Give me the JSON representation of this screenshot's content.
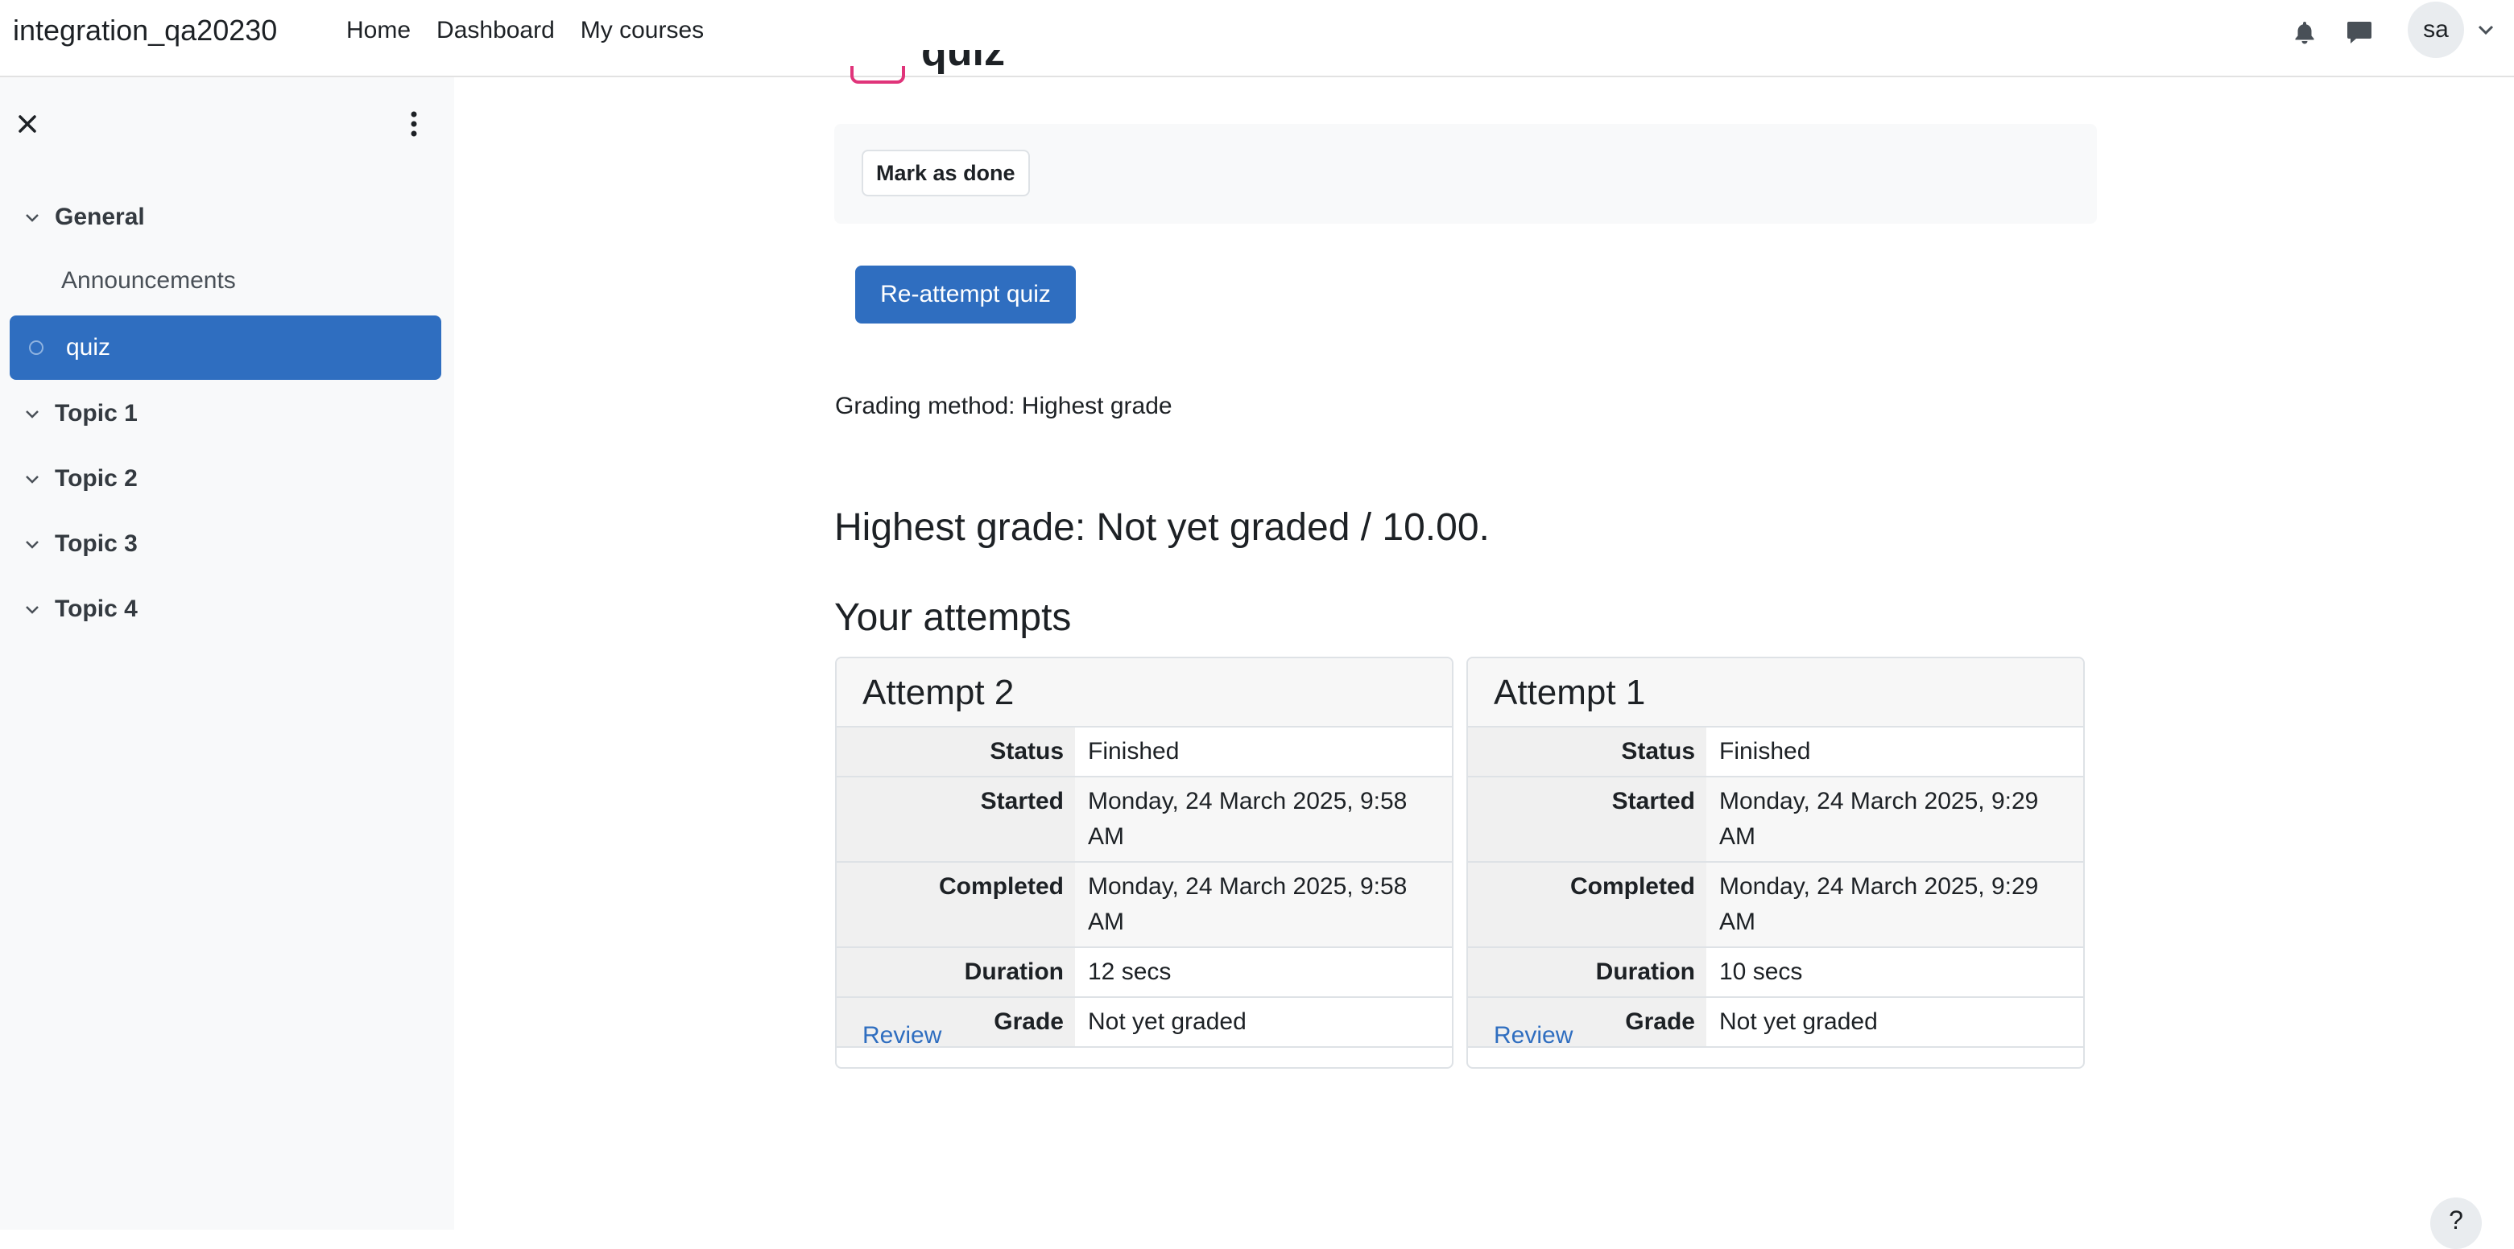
{
  "navbar": {
    "site_name": "integration_qa20230",
    "links": [
      "Home",
      "Dashboard",
      "My courses"
    ],
    "avatar_initials": "sa",
    "icons": [
      "bell-icon",
      "chat-icon",
      "chevron-down-icon"
    ]
  },
  "drawer": {
    "sections": [
      {
        "label": "General"
      },
      {
        "label": "Topic 1"
      },
      {
        "label": "Topic 2"
      },
      {
        "label": "Topic 3"
      },
      {
        "label": "Topic 4"
      }
    ],
    "activities": [
      "Announcements",
      "quiz"
    ]
  },
  "main": {
    "title_partial": "quiz",
    "mark_done_label": "Mark as done",
    "reattempt_label": "Re-attempt quiz",
    "grading_method": "Grading method: Highest grade",
    "highest_grade": "Highest grade: Not yet graded / 10.00.",
    "attempts_heading": "Your attempts",
    "attempts": [
      {
        "title": "Attempt 2",
        "rows": [
          {
            "label": "Status",
            "value": "Finished"
          },
          {
            "label": "Started",
            "value": "Monday, 24 March 2025, 9:58 AM"
          },
          {
            "label": "Completed",
            "value": "Monday, 24 March 2025, 9:58 AM"
          },
          {
            "label": "Duration",
            "value": "12 secs"
          },
          {
            "label": "Grade",
            "value": "Not yet graded"
          }
        ],
        "review_label": "Review"
      },
      {
        "title": "Attempt 1",
        "rows": [
          {
            "label": "Status",
            "value": "Finished"
          },
          {
            "label": "Started",
            "value": "Monday, 24 March 2025, 9:29 AM"
          },
          {
            "label": "Completed",
            "value": "Monday, 24 March 2025, 9:29 AM"
          },
          {
            "label": "Duration",
            "value": "10 secs"
          },
          {
            "label": "Grade",
            "value": "Not yet graded"
          }
        ],
        "review_label": "Review"
      }
    ]
  },
  "help_label": "?",
  "colors": {
    "primary": "#2f6ec0",
    "quiz_icon": "#e0347a"
  }
}
